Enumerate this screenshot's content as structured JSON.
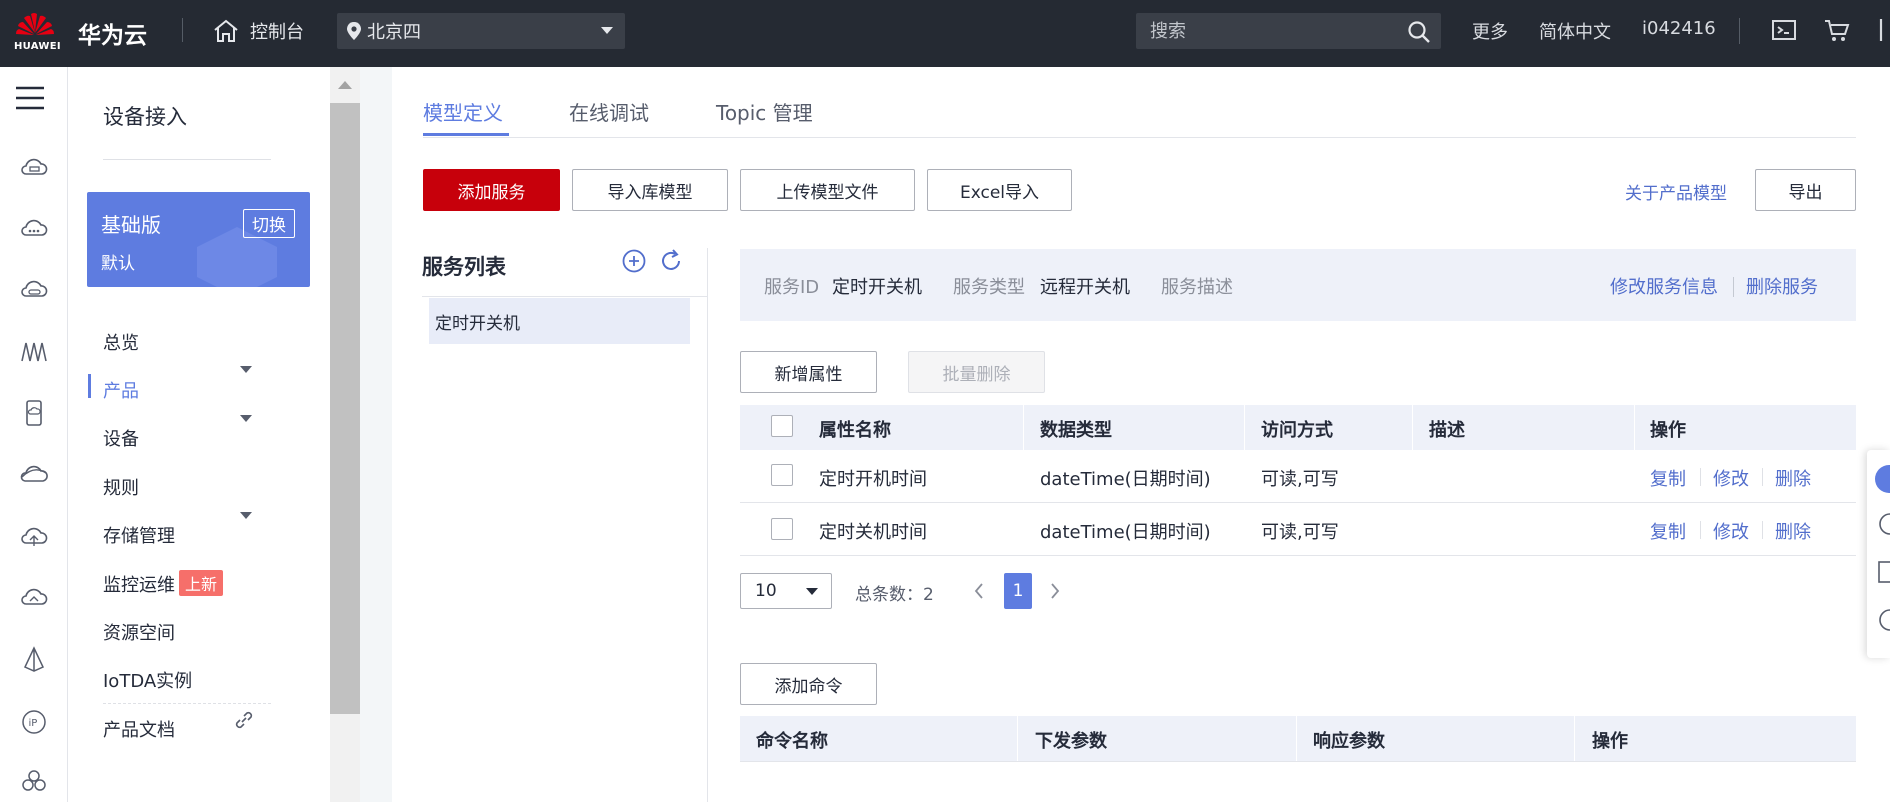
{
  "topbar": {
    "logo_text": "HUAWEI",
    "brand": "华为云",
    "console": "控制台",
    "region": "北京四",
    "search_placeholder": "搜索",
    "more": "更多",
    "language": "简体中文",
    "user": "i042416"
  },
  "nav": {
    "title": "设备接入",
    "plan": {
      "name": "基础版",
      "switch": "切换",
      "sub": "默认"
    },
    "items": [
      {
        "label": "总览"
      },
      {
        "label": "产品"
      },
      {
        "label": "设备"
      },
      {
        "label": "规则"
      },
      {
        "label": "存储管理"
      },
      {
        "label": "监控运维"
      },
      {
        "label": "资源空间"
      },
      {
        "label": "IoTDA实例"
      },
      {
        "label": "产品文档"
      }
    ],
    "new_badge": "上新"
  },
  "tabs": [
    {
      "label": "模型定义"
    },
    {
      "label": "在线调试"
    },
    {
      "label": "Topic 管理"
    }
  ],
  "toolbar": {
    "add_service": "添加服务",
    "import_lib": "导入库模型",
    "upload_model": "上传模型文件",
    "excel_import": "Excel导入",
    "about_model": "关于产品模型",
    "export": "导出"
  },
  "service_list": {
    "title": "服务列表",
    "items": [
      {
        "label": "定时开关机"
      }
    ]
  },
  "service_info": {
    "id_label": "服务ID",
    "id_value": "定时开关机",
    "type_label": "服务类型",
    "type_value": "远程开关机",
    "desc_label": "服务描述",
    "edit": "修改服务信息",
    "delete": "删除服务"
  },
  "properties": {
    "add": "新增属性",
    "batch_delete": "批量删除",
    "columns": [
      "属性名称",
      "数据类型",
      "访问方式",
      "描述",
      "操作"
    ],
    "rows": [
      {
        "name": "定时开机时间",
        "type": "dateTime(日期时间)",
        "access": "可读,可写",
        "desc": ""
      },
      {
        "name": "定时关机时间",
        "type": "dateTime(日期时间)",
        "access": "可读,可写",
        "desc": ""
      }
    ],
    "ops": {
      "copy": "复制",
      "edit": "修改",
      "delete": "删除"
    },
    "pagination": {
      "page_size": "10",
      "total": "总条数：2",
      "current": "1"
    }
  },
  "commands": {
    "add": "添加命令",
    "columns": [
      "命令名称",
      "下发参数",
      "响应参数",
      "操作"
    ]
  },
  "colors": {
    "topbar": "#252a33",
    "primary": "#c7000b",
    "accent": "#5e7ce0",
    "link": "#526ecc"
  }
}
